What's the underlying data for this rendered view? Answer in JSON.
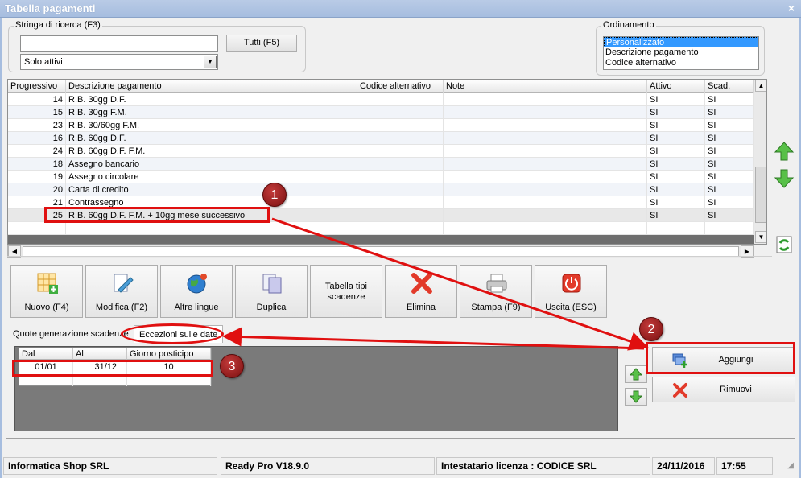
{
  "window": {
    "title": "Tabella pagamenti",
    "close_glyph": "×"
  },
  "search": {
    "group_label": "Stringa di ricerca (F3)",
    "input_value": "",
    "all_button": "Tutti (F5)",
    "filter_value": "Solo attivi"
  },
  "sort": {
    "group_label": "Ordinamento",
    "options": [
      "Personalizzato",
      "Descrizione pagamento",
      "Codice alternativo"
    ],
    "selected": "Personalizzato"
  },
  "grid": {
    "headers": [
      "Progressivo",
      "Descrizione pagamento",
      "Codice alternativo",
      "Note",
      "Attivo",
      "Scad."
    ],
    "rows": [
      {
        "progressivo": "14",
        "descrizione": "R.B. 30gg D.F.",
        "codice": "",
        "note": "",
        "attivo": "SI",
        "scad": "SI"
      },
      {
        "progressivo": "15",
        "descrizione": "R.B. 30gg F.M.",
        "codice": "",
        "note": "",
        "attivo": "SI",
        "scad": "SI"
      },
      {
        "progressivo": "23",
        "descrizione": "R.B. 30/60gg F.M.",
        "codice": "",
        "note": "",
        "attivo": "SI",
        "scad": "SI"
      },
      {
        "progressivo": "16",
        "descrizione": "R.B. 60gg D.F.",
        "codice": "",
        "note": "",
        "attivo": "SI",
        "scad": "SI"
      },
      {
        "progressivo": "24",
        "descrizione": "R.B. 60gg D.F. F.M.",
        "codice": "",
        "note": "",
        "attivo": "SI",
        "scad": "SI"
      },
      {
        "progressivo": "18",
        "descrizione": "Assegno bancario",
        "codice": "",
        "note": "",
        "attivo": "SI",
        "scad": "SI"
      },
      {
        "progressivo": "19",
        "descrizione": "Assegno circolare",
        "codice": "",
        "note": "",
        "attivo": "SI",
        "scad": "SI"
      },
      {
        "progressivo": "20",
        "descrizione": "Carta di credito",
        "codice": "",
        "note": "",
        "attivo": "SI",
        "scad": "SI"
      },
      {
        "progressivo": "21",
        "descrizione": "Contrassegno",
        "codice": "",
        "note": "",
        "attivo": "SI",
        "scad": "SI"
      },
      {
        "progressivo": "25",
        "descrizione": "R.B. 60gg D.F. F.M. + 10gg mese successivo",
        "codice": "",
        "note": "",
        "attivo": "SI",
        "scad": "SI"
      }
    ]
  },
  "toolbar": {
    "nuovo": "Nuovo (F4)",
    "modifica": "Modifica (F2)",
    "altre_lingue": "Altre lingue",
    "duplica": "Duplica",
    "tabella_tipi": "Tabella tipi scadenze",
    "elimina": "Elimina",
    "stampa": "Stampa (F9)",
    "uscita": "Uscita (ESC)"
  },
  "tabs": {
    "quote": "Quote generazione scadenze",
    "eccezioni": "Eccezioni sulle date"
  },
  "exceptions": {
    "headers": [
      "Dal",
      "Al",
      "Giorno posticipo"
    ],
    "row": {
      "dal": "01/01",
      "al": "31/12",
      "giorno": "10"
    }
  },
  "actions": {
    "aggiungi": "Aggiungi",
    "rimuovi": "Rimuovi"
  },
  "callouts": [
    "1",
    "2",
    "3"
  ],
  "status": {
    "company": "Informatica Shop SRL",
    "version": "Ready Pro V18.9.0",
    "license": "Intestatario licenza : CODICE SRL",
    "date": "24/11/2016",
    "time": "17:55"
  },
  "colors": {
    "title_bg": "#a6bddf",
    "highlight_red": "#e01010",
    "selection_blue": "#3399ff"
  }
}
